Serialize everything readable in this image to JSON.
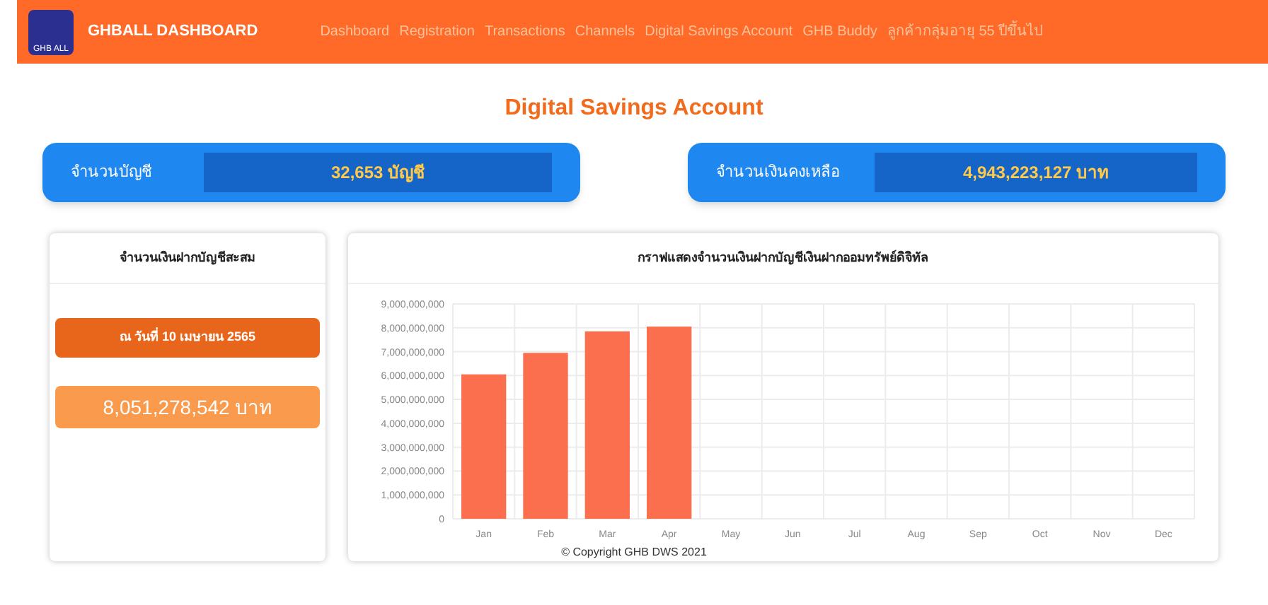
{
  "navbar": {
    "logo_text": "GHB ALL",
    "brand": "GHBALL DASHBOARD",
    "items": [
      {
        "label": "Dashboard",
        "selected": false
      },
      {
        "label": "Registration",
        "selected": false
      },
      {
        "label": "Transactions",
        "selected": false
      },
      {
        "label": "Channels",
        "selected": false
      },
      {
        "label": "Digital Savings Account",
        "selected": false
      },
      {
        "label": "GHB Buddy",
        "selected": false
      },
      {
        "label": "ลูกค้ากลุ่มอายุ 55 ปีขึ้นไป",
        "selected": false
      }
    ]
  },
  "page_title": "Digital Savings Account",
  "stats": [
    {
      "label": "จำนวนบัญชี",
      "value": "32,653 บัญชี"
    },
    {
      "label": "จำนวนเงินคงเหลือ",
      "value": "4,943,223,127 บาท"
    }
  ],
  "summary_card": {
    "title": "จำนวนเงินฝากบัญชีสะสม",
    "date": "ณ วันที่ 10 เมษายน 2565",
    "amount": "8,051,278,542 บาท"
  },
  "chart_card": {
    "title": "กราฟแสดงจำนวนเงินฝากบัญชีเงินฝากออมทรัพย์ดิจิทัล",
    "chart_data": {
      "type": "bar",
      "categories": [
        "Jan",
        "Feb",
        "Mar",
        "Apr",
        "May",
        "Jun",
        "Jul",
        "Aug",
        "Sep",
        "Oct",
        "Nov",
        "Dec"
      ],
      "grid": true,
      "series": [
        {
          "color": "#fb6f4f",
          "values": [
            6050000000,
            6950000000,
            7850000000,
            8050000000,
            null,
            null,
            null,
            null,
            null,
            null,
            null,
            null
          ]
        }
      ],
      "ylim": [
        0,
        9000000000
      ],
      "yticks": [
        {
          "value": 0,
          "label": "0"
        },
        {
          "value": 1000000000,
          "label": "1,000,000,000"
        },
        {
          "value": 2000000000,
          "label": "2,000,000,000"
        },
        {
          "value": 3000000000,
          "label": "3,000,000,000"
        },
        {
          "value": 4000000000,
          "label": "4,000,000,000"
        },
        {
          "value": 5000000000,
          "label": "5,000,000,000"
        },
        {
          "value": 6000000000,
          "label": "6,000,000,000"
        },
        {
          "value": 7000000000,
          "label": "7,000,000,000"
        },
        {
          "value": 8000000000,
          "label": "8,000,000,000"
        },
        {
          "value": 9000000000,
          "label": "9,000,000,000"
        }
      ]
    }
  },
  "footer": "© Copyright GHB DWS 2021"
}
